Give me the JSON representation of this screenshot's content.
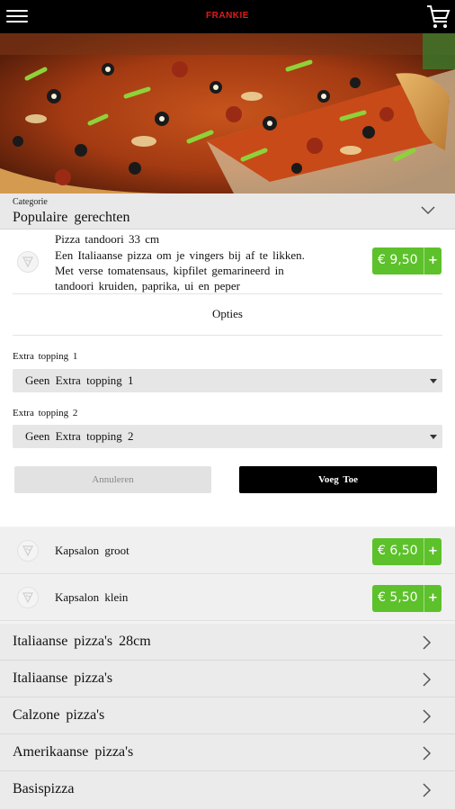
{
  "header": {
    "brand": "FRANKIE",
    "menu_icon": "hamburger-icon",
    "cart_icon": "shopping-cart-icon",
    "brand_color": "#e01b1b"
  },
  "category": {
    "label": "Categorie",
    "value": "Populaire   gerechten",
    "icon": "chevron-down-icon"
  },
  "selected_product": {
    "title": "Pizza  tandoori  33 cm",
    "description_lines": [
      "Een  Italiaanse  pizza  om je vingers  bij af te  likken.",
      "Met verse  tomatensaus,   kipfilet gemarineerd   in",
      "tandoori  kruiden,  paprika, ui en  peper"
    ],
    "price": "€ 9,50",
    "plus": "+",
    "options_title": "Opties",
    "options": [
      {
        "label": "Extra  topping  1",
        "value": "Geen  Extra  topping  1"
      },
      {
        "label": "Extra  topping  2",
        "value": "Geen  Extra  topping  2"
      }
    ],
    "cancel_label": "Annuleren",
    "add_label": "Voeg  Toe"
  },
  "products": [
    {
      "name": "Kapsalon   groot",
      "price": "€ 6,50",
      "plus": "+"
    },
    {
      "name": "Kapsalon   klein",
      "price": "€ 5,50",
      "plus": "+"
    }
  ],
  "categories": [
    {
      "label": "Italiaanse  pizza's  28cm"
    },
    {
      "label": "Italiaanse   pizza's"
    },
    {
      "label": "Calzone   pizza's"
    },
    {
      "label": "Amerikaanse   pizza's"
    },
    {
      "label": "Basispizza"
    }
  ],
  "colors": {
    "accent_green": "#5cc12a",
    "topbar": "#000000"
  }
}
